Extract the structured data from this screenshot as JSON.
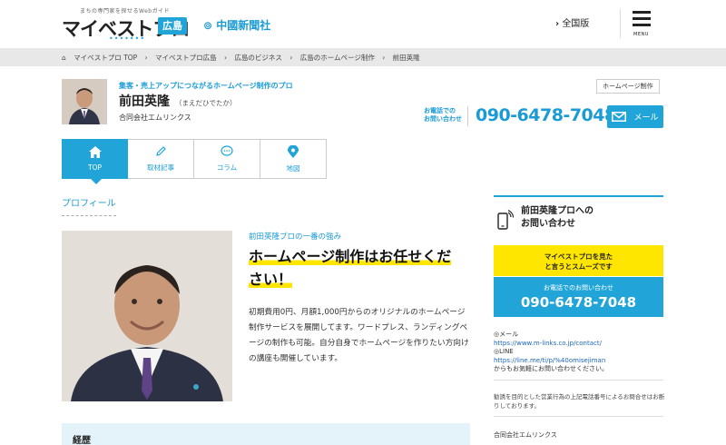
{
  "header": {
    "logo_tagline": "まちの専門家を探せるWebガイド",
    "logo_text": "マイベストプロ",
    "logo_area": "広島",
    "paper_name": "中國新聞社",
    "nationwide_link": "全国版",
    "menu_label": "MENU"
  },
  "breadcrumb": [
    "マイベストプロ TOP",
    "マイベストプロ広島",
    "広島のビジネス",
    "広島のホームページ制作",
    "前田英隆"
  ],
  "profile": {
    "tagline": "集客・売上アップにつながるホームページ制作のプロ",
    "name": "前田英隆",
    "kana": "（まえだひでたか）",
    "company": "合同会社エムリンクス",
    "category_badge": "ホームページ制作",
    "phone_label_line1": "お電話での",
    "phone_label_line2": "お問い合わせ",
    "phone": "090-6478-7048",
    "mail_label": "メール"
  },
  "tabs": [
    {
      "label": "TOP",
      "icon": "home-icon",
      "active": true
    },
    {
      "label": "取材記事",
      "icon": "pencil-icon",
      "active": false
    },
    {
      "label": "コラム",
      "icon": "chat-icon",
      "active": false
    },
    {
      "label": "地図",
      "icon": "map-pin-icon",
      "active": false
    }
  ],
  "main": {
    "section_title": "プロフィール",
    "strength_label": "前田英隆プロの一番の強み",
    "headline_line1": "ホームページ制作はお任せくだ",
    "headline_line2": "さい！",
    "description": "初期費用0円、月額1,000円からのオリジナルのホームページ制作サービスを展開してます。ワードプレス、ランディングページの制作も可能。自分自身でホームページを作りたい方向けの講座も開催しています。",
    "career_label": "経歴"
  },
  "sidebar": {
    "contact_title_line1": "前田英隆プロへの",
    "contact_title_line2": "お問い合わせ",
    "yellow_line1": "マイベストプロを見た",
    "yellow_line2": "と言うとスムーズです",
    "phone_label": "お電話でのお問い合わせ",
    "phone": "090-6478-7048",
    "mail_heading": "◎メール",
    "mail_url": "https://www.m-links.co.jp/contact/",
    "line_heading": "◎LINE",
    "line_url": "https://line.me/ti/p/%40omisejiman",
    "line_note": "からもお気軽にお問い合わせください。",
    "notice": "勧誘を目的とした営業行為の上記電話番号によるお問合せはお断りしております。",
    "company": "合同会社エムリンクス"
  },
  "colors": {
    "accent": "#21a5d8",
    "highlight": "#ffe600"
  }
}
